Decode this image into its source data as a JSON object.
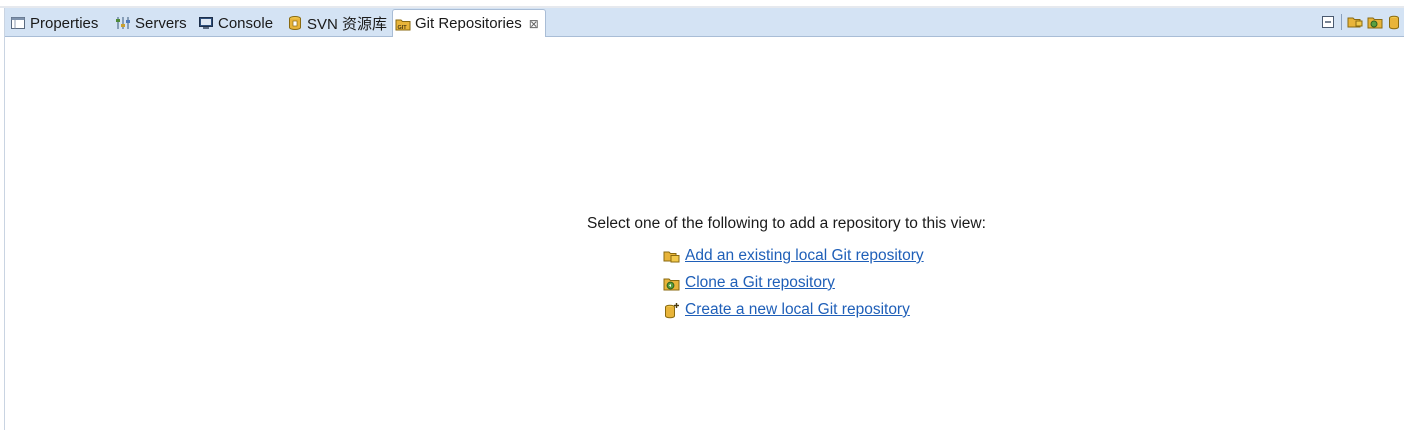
{
  "tabs": [
    {
      "label": "Properties",
      "icon": "properties-icon"
    },
    {
      "label": "Servers",
      "icon": "servers-icon"
    },
    {
      "label": "Console",
      "icon": "console-icon"
    },
    {
      "label": "SVN 资源库",
      "icon": "svn-repository-icon"
    },
    {
      "label": "Git Repositories",
      "icon": "git-repositories-icon",
      "active": true,
      "close": "⊠"
    }
  ],
  "toolbar": {
    "buttons": [
      "minimize-icon",
      "add-repository-icon",
      "clone-repository-icon",
      "create-repository-icon"
    ]
  },
  "main": {
    "prompt": "Select one of the following to add a repository to this view:",
    "actions": [
      {
        "label": "Add an existing local Git repository",
        "icon": "add-existing-repository-icon"
      },
      {
        "label": "Clone a Git repository",
        "icon": "clone-repository-icon"
      },
      {
        "label": "Create a new local Git repository",
        "icon": "create-repository-icon"
      }
    ]
  },
  "colors": {
    "tabbar": "#d4e3f4",
    "link": "#1f5fb8",
    "folder": "#e8b43a"
  }
}
